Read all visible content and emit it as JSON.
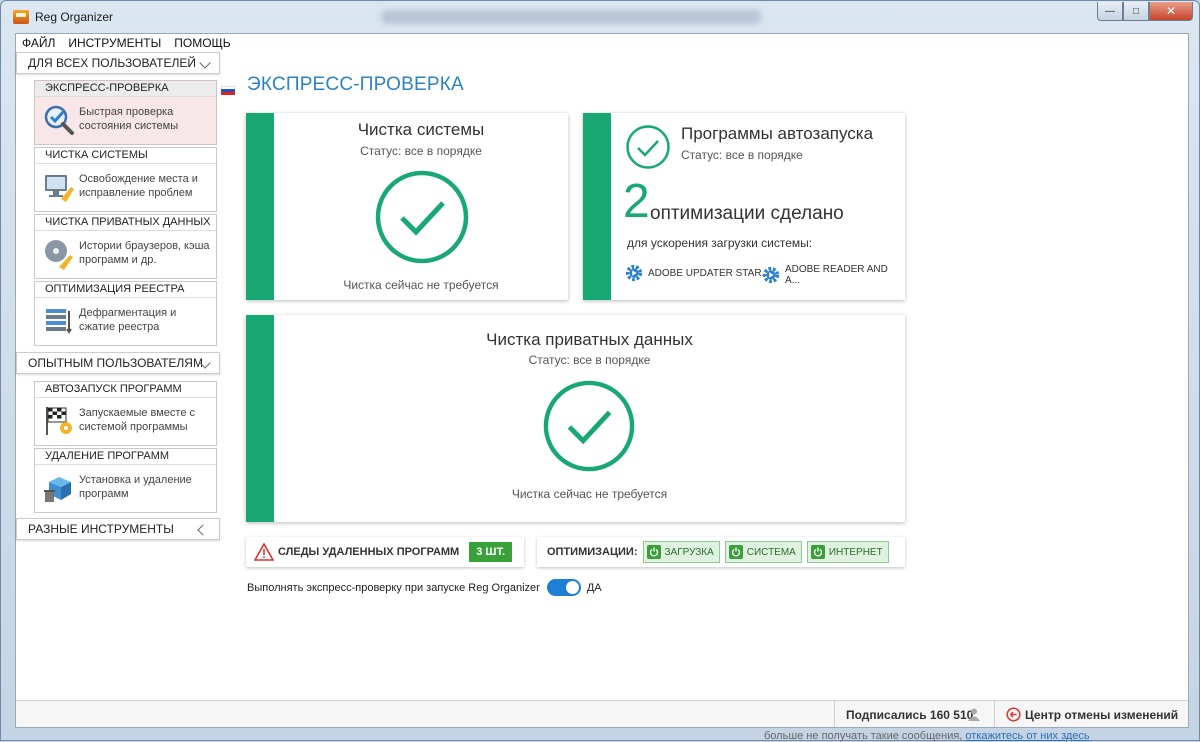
{
  "window": {
    "title": "Reg Organizer",
    "minimize_glyph": "—",
    "maximize_glyph": "□",
    "close_glyph": "✕"
  },
  "menu": [
    "ФАЙЛ",
    "ИНСТРУМЕНТЫ",
    "ПОМОЩЬ"
  ],
  "sidebar": {
    "group_all": "ДЛЯ ВСЕХ ПОЛЬЗОВАТЕЛЕЙ",
    "group_expert": "ОПЫТНЫМ ПОЛЬЗОВАТЕЛЯМ",
    "group_misc": "РАЗНЫЕ ИНСТРУМЕНТЫ",
    "tools": [
      {
        "title": "Экспресс-проверка",
        "desc": "Быстрая проверка состояния системы",
        "icon": "magnifier-check-icon"
      },
      {
        "title": "Чистка системы",
        "desc": "Освобождение места и исправление проблем",
        "icon": "broom-monitor-icon"
      },
      {
        "title": "Чистка приватных данных",
        "desc": "Истории браузеров, кэша программ и др.",
        "icon": "broom-disk-icon"
      },
      {
        "title": "Оптимизация реестра",
        "desc": "Дефрагментация и сжатие реестра",
        "icon": "registry-icon"
      },
      {
        "title": "Автозапуск программ",
        "desc": "Запускаемые вместе с системой программы",
        "icon": "flag-gear-icon"
      },
      {
        "title": "Удаление программ",
        "desc": "Установка и удаление программ",
        "icon": "box-trash-icon"
      }
    ]
  },
  "main": {
    "title": "ЭКСПРЕСС-ПРОВЕРКА",
    "card_system": {
      "title": "Чистка системы",
      "status": "Статус: все в порядке",
      "foot": "Чистка сейчас не требуется"
    },
    "card_autorun": {
      "title": "Программы автозапуска",
      "status": "Статус: все в порядке",
      "count": "2",
      "optimized": "оптимизации сделано",
      "subtitle": "для ускорения загрузки системы:",
      "tasks": [
        "ADOBE UPDATER STAR...",
        "ADOBE READER AND A..."
      ]
    },
    "card_private": {
      "title": "Чистка приватных данных",
      "status": "Статус: все в порядке",
      "foot": "Чистка сейчас не требуется"
    },
    "leftovers": {
      "label": "СЛЕДЫ УДАЛЕННЫХ ПРОГРАММ",
      "count": "3 ШТ."
    },
    "optimizations": {
      "label": "ОПТИМИЗАЦИИ:",
      "buttons": [
        "ЗАГРУЗКА",
        "СИСТЕМА",
        "ИНТЕРНЕТ"
      ]
    },
    "autorun_check": {
      "label": "Выполнять экспресс-проверку при запуске Reg Organizer",
      "value": "ДА"
    }
  },
  "statusbar": {
    "subscribers": "Подписались 160 510",
    "undo_center": "Центр отмены изменений"
  },
  "behind": {
    "text": "больше не получать такие сообщения,",
    "link": "откажитесь от них здесь"
  },
  "colors": {
    "accent_green": "#18a874",
    "title_blue": "#2a82c7",
    "toggle_blue": "#1e7fd6"
  }
}
